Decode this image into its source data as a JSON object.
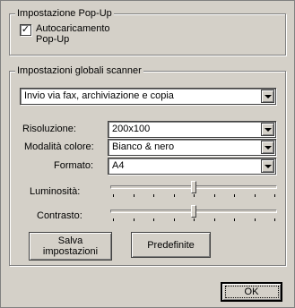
{
  "popup_group": {
    "title": "Impostazione Pop-Up",
    "autoload_checked_mark": "✓",
    "autoload_label": "Autocaricamento Pop-Up"
  },
  "scanner_group": {
    "title": "Impostazioni globali scanner",
    "mode_combo": {
      "value": "Invio via fax, archiviazione e copia"
    },
    "resolution": {
      "label": "Risoluzione:",
      "value": "200x100"
    },
    "color_mode": {
      "label": "Modalità colore:",
      "value": "Bianco & nero"
    },
    "format": {
      "label": "Formato:",
      "value": "A4"
    },
    "brightness": {
      "label": "Luminosità:",
      "level": 0.5
    },
    "contrast": {
      "label": "Contrasto:",
      "level": 0.5
    },
    "save_button": "Salva impostazioni",
    "defaults_button": "Predefinite"
  },
  "ok_button": "OK",
  "icons": {
    "dropdown": "chevron-down-icon",
    "check": "checkmark-icon"
  }
}
